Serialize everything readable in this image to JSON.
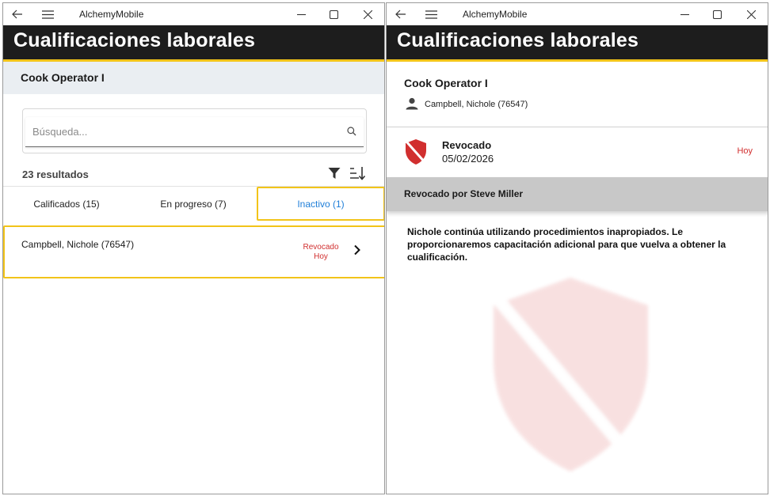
{
  "colors": {
    "header_bg": "#1d1d1d",
    "accent_yellow": "#f2c419",
    "link_blue": "#1e7ed8",
    "revoked_red": "#d12f2f",
    "subheader_bg": "#eaeef2",
    "revoked_by_bg": "#c8c8c8"
  },
  "left_window": {
    "titlebar": {
      "back_icon": "arrow-left-icon",
      "menu_icon": "hamburger-icon",
      "title": "AlchemyMobile",
      "minimize_icon": "minimize-icon",
      "maximize_icon": "maximize-icon",
      "close_icon": "close-icon"
    },
    "header": {
      "title": "Cualificaciones laborales"
    },
    "subheader": {
      "title": "Cook Operator I"
    },
    "search": {
      "placeholder": "Búsqueda...",
      "icon": "search-icon"
    },
    "results_text": "23 resultados",
    "tabs": [
      {
        "label": "Calificados (15)",
        "selected": false
      },
      {
        "label": "En progreso (7)",
        "selected": false
      },
      {
        "label": "Inactivo (1)",
        "selected": true
      }
    ],
    "list": [
      {
        "name": "Campbell, Nichole (76547)",
        "status": "Revocado",
        "when": "Hoy"
      }
    ]
  },
  "right_window": {
    "titlebar": {
      "back_icon": "arrow-left-icon",
      "menu_icon": "hamburger-icon",
      "title": "AlchemyMobile",
      "minimize_icon": "minimize-icon",
      "maximize_icon": "maximize-icon",
      "close_icon": "close-icon"
    },
    "header": {
      "title": "Cualificaciones laborales"
    },
    "qualification": "Cook Operator I",
    "person": "Campbell, Nichole (76547)",
    "status": {
      "label": "Revocado",
      "date": "05/02/2026",
      "when": "Hoy",
      "icon": "revoked-shield-icon"
    },
    "revoked_by": "Revocado por Steve Miller",
    "note": "Nichole continúa utilizando procedimientos inapropiados. Le proporcionaremos capacitación adicional para que vuelva a obtener la cualificación."
  }
}
